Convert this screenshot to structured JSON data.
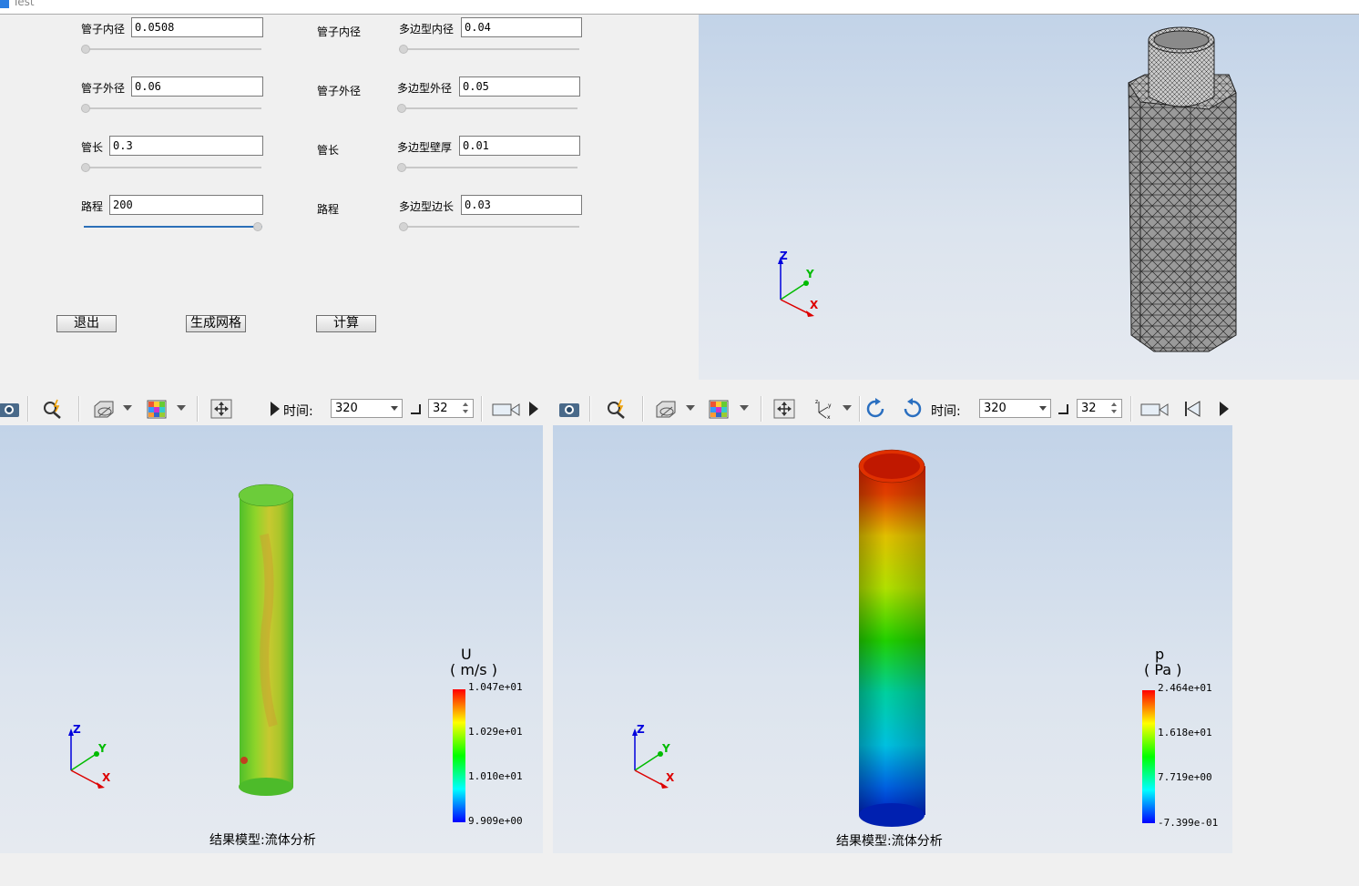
{
  "window": {
    "title": "Test"
  },
  "params": {
    "col1": [
      {
        "label": "管子内径",
        "value": "0.0508"
      },
      {
        "label": "管子外径",
        "value": "0.06"
      },
      {
        "label": "管长",
        "value": "0.3"
      },
      {
        "label": "路程",
        "value": "200"
      }
    ],
    "col2": [
      "管子内径",
      "管子外径",
      "管长",
      "路程"
    ],
    "col3": [
      {
        "label": "多边型内径",
        "value": "0.04"
      },
      {
        "label": "多边型外径",
        "value": "0.05"
      },
      {
        "label": "多边型壁厚",
        "value": "0.01"
      },
      {
        "label": "多边型边长",
        "value": "0.03"
      }
    ],
    "sliders": {
      "col1": [
        0,
        0,
        0,
        1
      ],
      "col3": [
        0,
        0,
        0,
        0
      ]
    }
  },
  "buttons": {
    "exit": "退出",
    "mesh": "生成网格",
    "compute": "计算"
  },
  "axes": {
    "x": "X",
    "y": "Y",
    "z": "Z"
  },
  "panels": {
    "left": {
      "time_label": "时间:",
      "time_value": "320",
      "step_value": "32",
      "legend_field": "U",
      "legend_unit": "( m/s )",
      "legend_ticks": [
        "1.047e+01",
        "1.029e+01",
        "1.010e+01",
        "9.909e+00"
      ],
      "caption": "结果模型:流体分析"
    },
    "right": {
      "time_label": "时间:",
      "time_value": "320",
      "step_value": "32",
      "legend_field": "p",
      "legend_unit": "( Pa )",
      "legend_ticks": [
        "2.464e+01",
        "1.618e+01",
        "7.719e+00",
        "-7.399e-01"
      ],
      "caption": "结果模型:流体分析"
    }
  },
  "colors": {
    "slider_fill": "#2b6fb8",
    "viewport_top": "#c2d3e8",
    "viewport_bottom": "#e6eaf0"
  }
}
